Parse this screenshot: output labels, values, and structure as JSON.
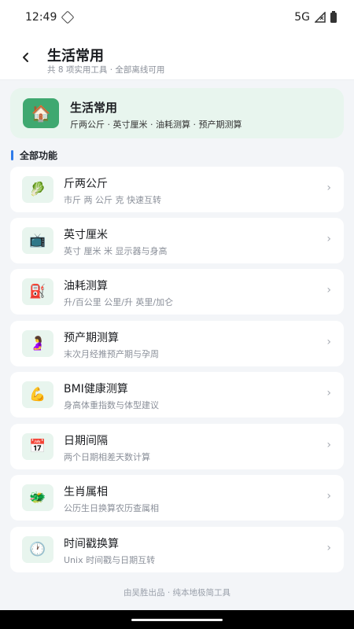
{
  "status_bar": {
    "time": "12:49",
    "network": "5G"
  },
  "header": {
    "back_icon": "chevron-left-icon",
    "title": "生活常用",
    "subtitle": "共 8 项实用工具 · 全部离线可用"
  },
  "hero": {
    "icon": "🏠",
    "title": "生活常用",
    "subtitle": "斤两公斤 · 英寸厘米 · 油耗测算 · 预产期测算"
  },
  "section": {
    "title": "全部功能",
    "accent": "#2f7bea"
  },
  "tools": [
    {
      "icon": "🥬",
      "title": "斤两公斤",
      "desc": "市斤 两 公斤 克 快速互转"
    },
    {
      "icon": "📺",
      "title": "英寸厘米",
      "desc": "英寸 厘米 米 显示器与身高"
    },
    {
      "icon": "⛽",
      "title": "油耗测算",
      "desc": "升/百公里 公里/升 英里/加仑"
    },
    {
      "icon": "🤰",
      "title": "预产期测算",
      "desc": "末次月经推预产期与孕周"
    },
    {
      "icon": "💪",
      "title": "BMI健康测算",
      "desc": "身高体重指数与体型建议"
    },
    {
      "icon": "📅",
      "title": "日期间隔",
      "desc": "两个日期相差天数计算"
    },
    {
      "icon": "🐲",
      "title": "生肖属相",
      "desc": "公历生日换算农历查属相"
    },
    {
      "icon": "🕐",
      "title": "时间戳换算",
      "desc": "Unix 时间戳与日期互转"
    }
  ],
  "chevron": "›",
  "footer": "由吴胜出品 · 纯本地极简工具",
  "colors": {
    "brand_green": "#3fa870",
    "hero_bg": "#e8f5ee",
    "page_bg": "#f3f5f8"
  }
}
